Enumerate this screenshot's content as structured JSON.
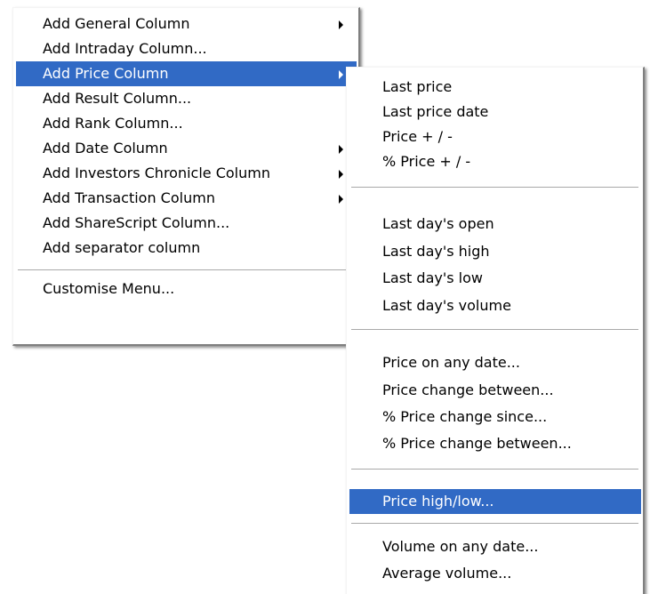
{
  "colors": {
    "highlight_bg": "#316ac5",
    "highlight_text": "#ffffff",
    "menu_bg": "#ffffff",
    "separator": "#a9a9a9"
  },
  "main_menu": {
    "items": [
      {
        "label": "Add General Column",
        "has_submenu": true
      },
      {
        "label": "Add Intraday Column...",
        "has_submenu": false
      },
      {
        "label": "Add Price Column",
        "has_submenu": true,
        "highlighted": true
      },
      {
        "label": "Add Result Column...",
        "has_submenu": false
      },
      {
        "label": "Add Rank Column...",
        "has_submenu": false
      },
      {
        "label": "Add Date Column",
        "has_submenu": true
      },
      {
        "label": "Add Investors Chronicle Column",
        "has_submenu": true
      },
      {
        "label": "Add Transaction Column",
        "has_submenu": true
      },
      {
        "label": "Add ShareScript Column...",
        "has_submenu": false
      },
      {
        "label": "Add separator column",
        "has_submenu": false
      },
      {
        "label": "Customise Menu...",
        "has_submenu": false
      }
    ]
  },
  "price_submenu": {
    "items": [
      {
        "label": "Last price"
      },
      {
        "label": "Last price date"
      },
      {
        "label": "Price + / -"
      },
      {
        "label": "% Price + / -"
      },
      {
        "label": "Last day's open"
      },
      {
        "label": "Last day's high"
      },
      {
        "label": "Last day's low"
      },
      {
        "label": "Last day's volume"
      },
      {
        "label": "Price on any date..."
      },
      {
        "label": "Price change between..."
      },
      {
        "label": "% Price change since..."
      },
      {
        "label": "% Price change between..."
      },
      {
        "label": "Price high/low...",
        "highlighted": true
      },
      {
        "label": "Volume on any date..."
      },
      {
        "label": "Average volume..."
      }
    ]
  }
}
